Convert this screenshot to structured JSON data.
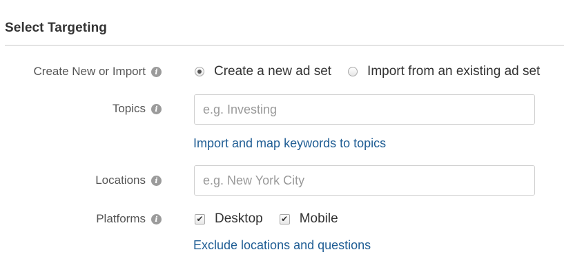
{
  "section": {
    "title": "Select Targeting"
  },
  "create_or_import": {
    "label": "Create New or Import",
    "options": [
      {
        "label": "Create a new ad set",
        "selected": true
      },
      {
        "label": "Import from an existing ad set",
        "selected": false
      }
    ]
  },
  "topics": {
    "label": "Topics",
    "placeholder": "e.g. Investing",
    "value": "",
    "link": "Import and map keywords to topics"
  },
  "locations": {
    "label": "Locations",
    "placeholder": "e.g. New York City",
    "value": ""
  },
  "platforms": {
    "label": "Platforms",
    "options": [
      {
        "label": "Desktop",
        "checked": true
      },
      {
        "label": "Mobile",
        "checked": true
      }
    ],
    "link": "Exclude locations and questions"
  },
  "icons": {
    "info": "info-icon",
    "check": "checkmark-icon"
  },
  "colors": {
    "link": "#1f5d94",
    "label": "#555555",
    "text": "#333333",
    "placeholder": "#9a9a9a",
    "info_icon": "#9b9b9b"
  }
}
